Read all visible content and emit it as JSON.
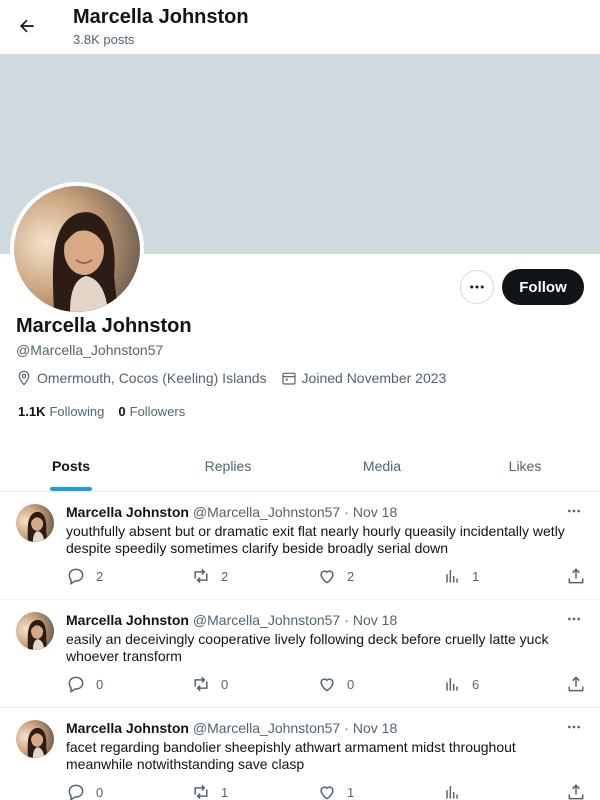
{
  "header": {
    "title": "Marcella Johnston",
    "post_count": "3.8K posts"
  },
  "profile": {
    "name": "Marcella Johnston",
    "handle": "@Marcella_Johnston57",
    "location": "Omermouth, Cocos (Keeling) Islands",
    "joined": "Joined November 2023",
    "following_count": "1.1K",
    "following_label": "Following",
    "followers_count": "0",
    "followers_label": "Followers",
    "follow_button": "Follow"
  },
  "tabs": [
    {
      "label": "Posts",
      "active": true
    },
    {
      "label": "Replies",
      "active": false
    },
    {
      "label": "Media",
      "active": false
    },
    {
      "label": "Likes",
      "active": false
    }
  ],
  "posts": [
    {
      "author": "Marcella Johnston",
      "handle": "@Marcella_Johnston57",
      "date": "Nov 18",
      "text": "youthfully absent but or dramatic exit flat nearly hourly queasily incidentally wetly despite speedily sometimes clarify beside broadly serial down",
      "replies": "2",
      "reposts": "2",
      "likes": "2",
      "views": "1"
    },
    {
      "author": "Marcella Johnston",
      "handle": "@Marcella_Johnston57",
      "date": "Nov 18",
      "text": "easily an deceivingly cooperative lively following deck before cruelly latte yuck whoever transform",
      "replies": "0",
      "reposts": "0",
      "likes": "0",
      "views": "6"
    },
    {
      "author": "Marcella Johnston",
      "handle": "@Marcella_Johnston57",
      "date": "Nov 18",
      "text": "facet regarding bandolier sheepishly athwart armament midst throughout meanwhile notwithstanding save clasp",
      "replies": "0",
      "reposts": "1",
      "likes": "1",
      "views": ""
    }
  ],
  "colors": {
    "banner": "#cfd9de",
    "accent": "#1d9bf0",
    "text": "#0f1419",
    "muted": "#536471"
  }
}
